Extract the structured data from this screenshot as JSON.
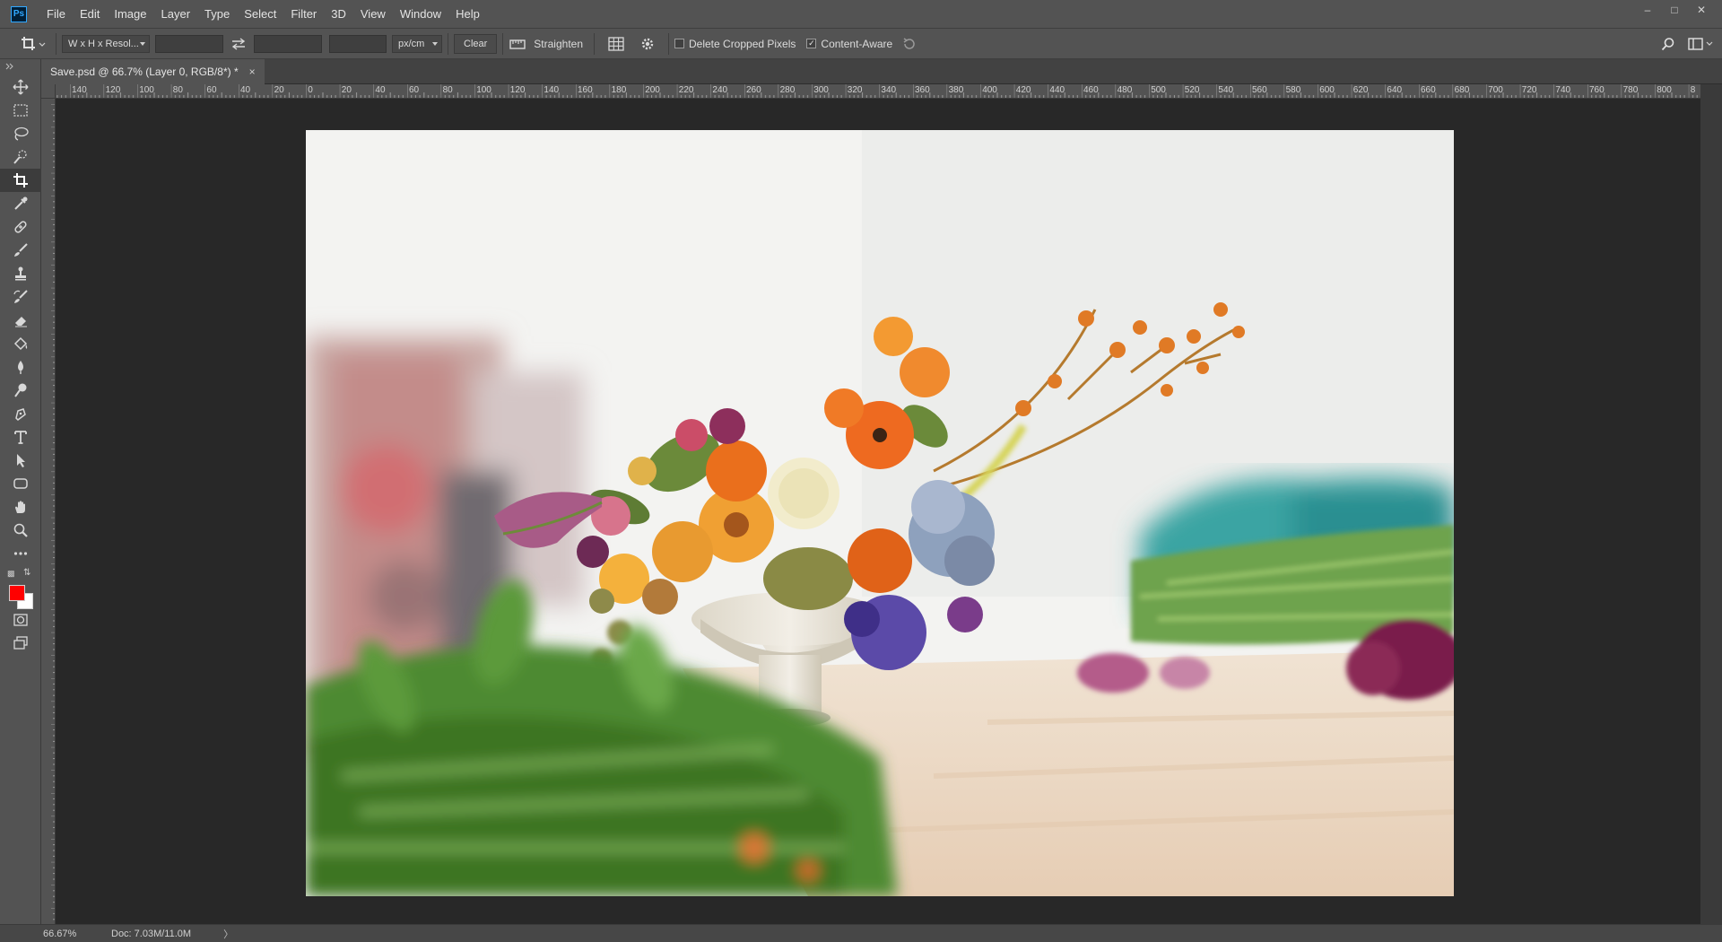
{
  "app": {
    "logo": "Ps"
  },
  "menu": [
    "File",
    "Edit",
    "Image",
    "Layer",
    "Type",
    "Select",
    "Filter",
    "3D",
    "View",
    "Window",
    "Help"
  ],
  "window_controls": {
    "minimize": "–",
    "restore": "□",
    "close": "✕"
  },
  "options": {
    "ratio_select": "W x H x Resol...",
    "units_select": "px/cm",
    "clear_label": "Clear",
    "straighten_label": "Straighten",
    "delete_cropped_label": "Delete Cropped Pixels",
    "delete_cropped_checked": false,
    "content_aware_label": "Content-Aware",
    "content_aware_checked": true
  },
  "document": {
    "tab_title": "Save.psd @ 66.7% (Layer 0, RGB/8*) *",
    "tab_close": "×"
  },
  "ruler_h": [
    "140",
    "120",
    "100",
    "80",
    "60",
    "40",
    "20",
    "0",
    "20",
    "40",
    "60",
    "80",
    "100",
    "120",
    "140",
    "160",
    "180",
    "200",
    "220",
    "240",
    "260",
    "280",
    "300",
    "320",
    "340",
    "360",
    "380",
    "400",
    "420",
    "440",
    "460",
    "480",
    "500",
    "520",
    "540",
    "560",
    "580",
    "600",
    "620",
    "640",
    "660",
    "680",
    "700",
    "720",
    "740",
    "760",
    "780",
    "800",
    "8"
  ],
  "toolbox": {
    "colors": {
      "foreground": "#ff0000",
      "background": "#ffffff"
    }
  },
  "status": {
    "zoom": "66.67%",
    "doc": "Doc: 7.03M/11.0M",
    "arrow": "〉"
  },
  "photo": {
    "subject": "flower-arrangement-photo"
  }
}
